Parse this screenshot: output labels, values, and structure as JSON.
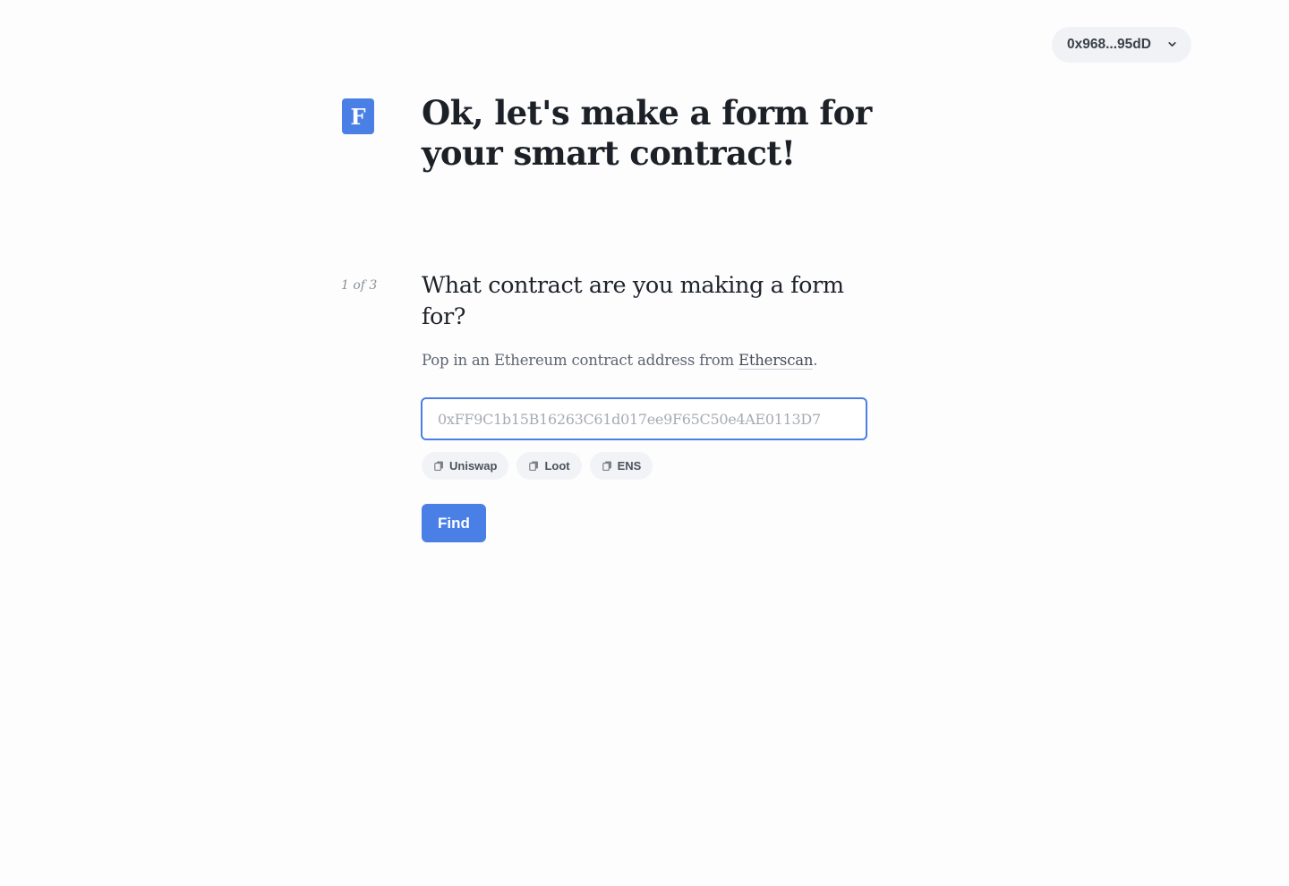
{
  "header": {
    "wallet_address": "0x968...95dD",
    "wallet_chevron_icon": "chevron-down-icon"
  },
  "logo": {
    "letter": "F"
  },
  "title": "Ok, let's make a form for your smart contract!",
  "step": {
    "counter": "1 of 3",
    "question": "What contract are you making a form for?",
    "helper_prefix": "Pop in an Ethereum contract address from ",
    "helper_link": "Etherscan",
    "helper_suffix": "."
  },
  "contract_input": {
    "value": "",
    "placeholder": "0xFF9C1b15B16263C61d017ee9F65C50e4AE0113D7"
  },
  "examples": [
    {
      "label": "Uniswap",
      "icon": "copy-icon"
    },
    {
      "label": "Loot",
      "icon": "copy-icon"
    },
    {
      "label": "ENS",
      "icon": "copy-icon"
    }
  ],
  "find_button": {
    "label": "Find"
  },
  "colors": {
    "accent": "#4a7fe6",
    "background": "#fdfdfe",
    "chip_background": "#f1f3f6"
  }
}
